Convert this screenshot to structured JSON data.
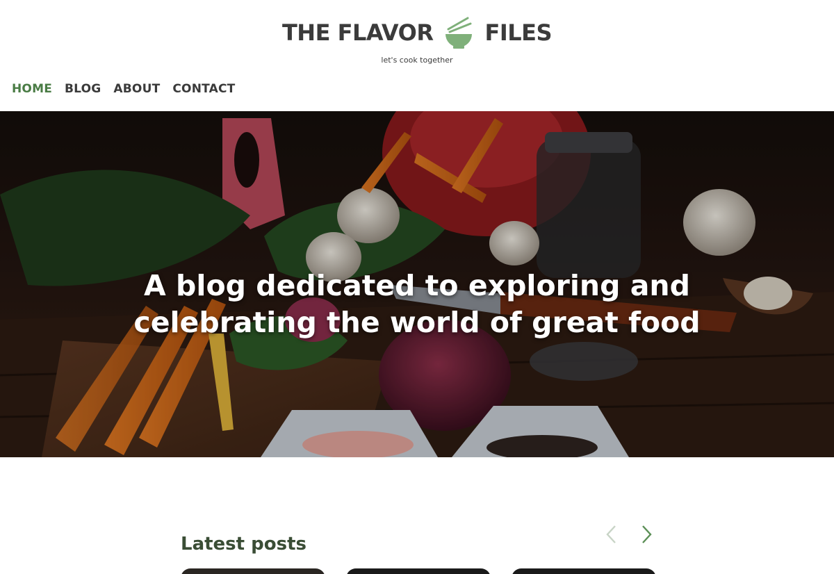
{
  "brand": {
    "word_left": "THE FLAVOR",
    "word_right": "FILES",
    "logo_icon": "rice-bowl-chopsticks-icon",
    "tagline": "let's cook together",
    "accent_color": "#7fb07a"
  },
  "nav": {
    "items": [
      {
        "label": "HOME",
        "active": true
      },
      {
        "label": "BLOG",
        "active": false
      },
      {
        "label": "ABOUT",
        "active": false
      },
      {
        "label": "CONTACT",
        "active": false
      }
    ],
    "active_color": "#4a7c45"
  },
  "hero": {
    "title": "A blog dedicated to exploring and celebrating the world of great food",
    "image_subject": "vegetables on wooden board"
  },
  "latest": {
    "title": "Latest posts",
    "prev_icon": "chevron-left-icon",
    "next_icon": "chevron-right-icon"
  }
}
